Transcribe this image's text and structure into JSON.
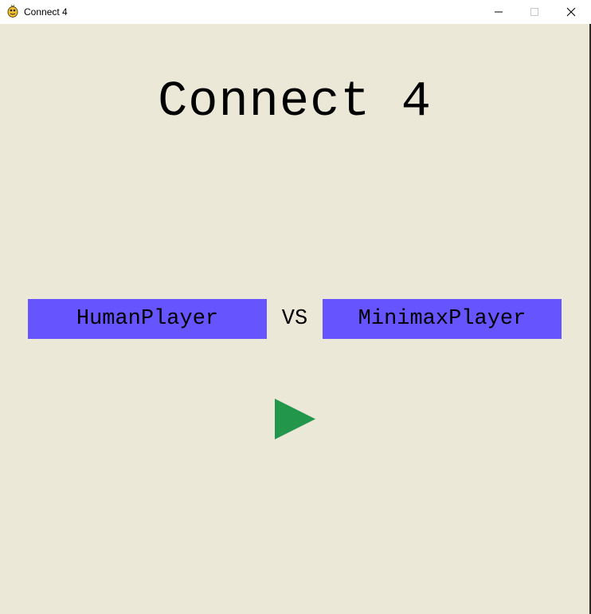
{
  "window": {
    "title": "Connect 4",
    "icon": "pygame-snake-icon",
    "controls": [
      "minimize-icon",
      "maximize-icon",
      "close-icon"
    ]
  },
  "game": {
    "title": "Connect 4",
    "player1": "HumanPlayer",
    "vs": "VS",
    "player2": "MinimaxPlayer",
    "play_icon": "play-icon"
  },
  "colors": {
    "background": "#ebe8d7",
    "player_button": "#6655ff",
    "play_button": "#22964a"
  }
}
